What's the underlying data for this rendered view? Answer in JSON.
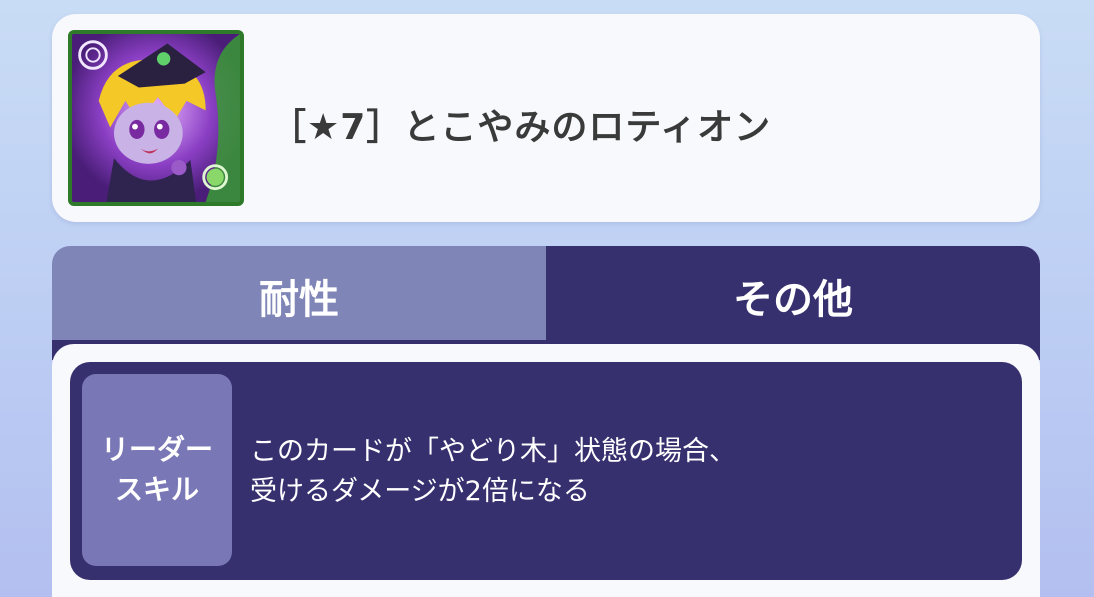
{
  "card": {
    "icon": "character-portrait-icon",
    "title": "［★7］とこやみのロティオン"
  },
  "tabs": [
    {
      "label": "耐性",
      "active": false
    },
    {
      "label": "その他",
      "active": true
    }
  ],
  "skill": {
    "label_line1": "リーダー",
    "label_line2": "スキル",
    "desc_line1": "このカードが「やどり木」状態の場合、",
    "desc_line2": "受けるダメージが2倍になる"
  },
  "colors": {
    "tab_active": "#37306f",
    "tab_inactive": "#7f85b6",
    "panel": "#f7f9fd",
    "skill_label_bg": "#7a77b6"
  }
}
